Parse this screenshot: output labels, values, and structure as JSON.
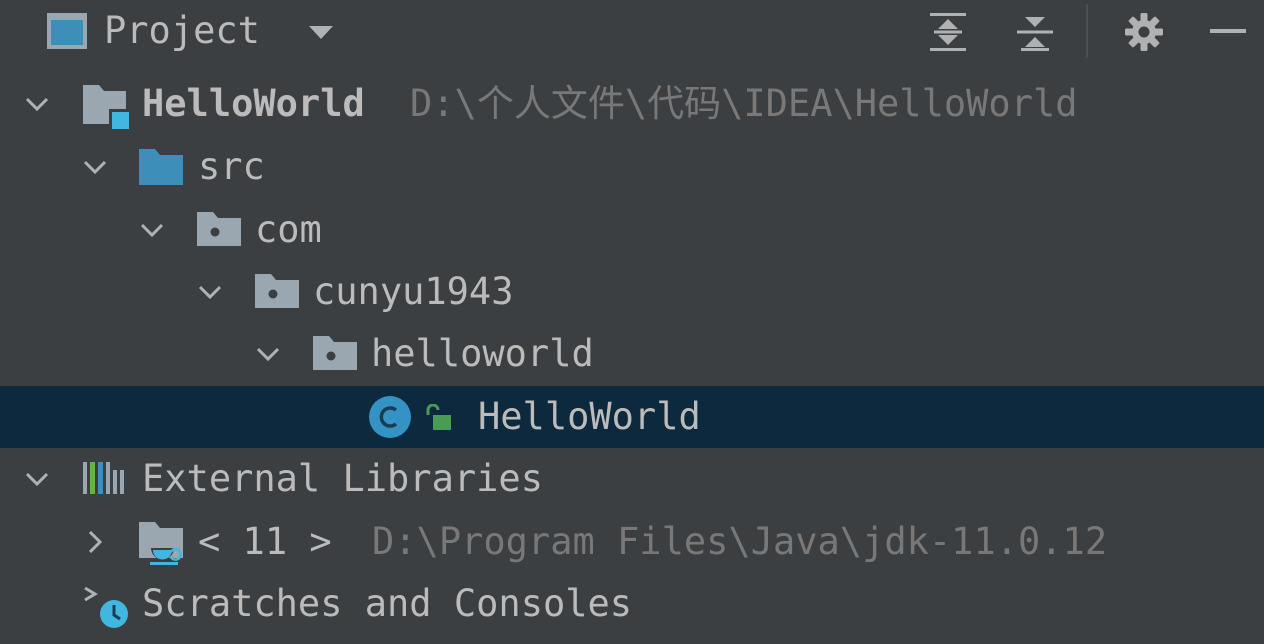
{
  "header": {
    "title": "Project",
    "toolbar": [
      "expand-all-icon",
      "collapse-all-icon",
      "gear-icon",
      "minimize-icon"
    ]
  },
  "tree": {
    "root": {
      "label": "HelloWorld",
      "path": "D:\\个人文件\\代码\\IDEA\\HelloWorld"
    },
    "src": {
      "label": "src"
    },
    "com": {
      "label": "com"
    },
    "cunyu": {
      "label": "cunyu1943"
    },
    "helloworld_pkg": {
      "label": "helloworld"
    },
    "class_file": {
      "label": "HelloWorld",
      "selected": true
    },
    "ext_libs": {
      "label": "External Libraries"
    },
    "jdk": {
      "label": "< 11 >",
      "path": "D:\\Program Files\\Java\\jdk-11.0.12"
    },
    "scratches": {
      "label": "Scratches and Consoles"
    }
  },
  "colors": {
    "background": "#3c3f41",
    "selection": "#0d293e",
    "folder_blue": "#3d8eb9",
    "folder_gray": "#9aa7b0",
    "class_blue": "#3592c4",
    "lock_green": "#499c54"
  }
}
